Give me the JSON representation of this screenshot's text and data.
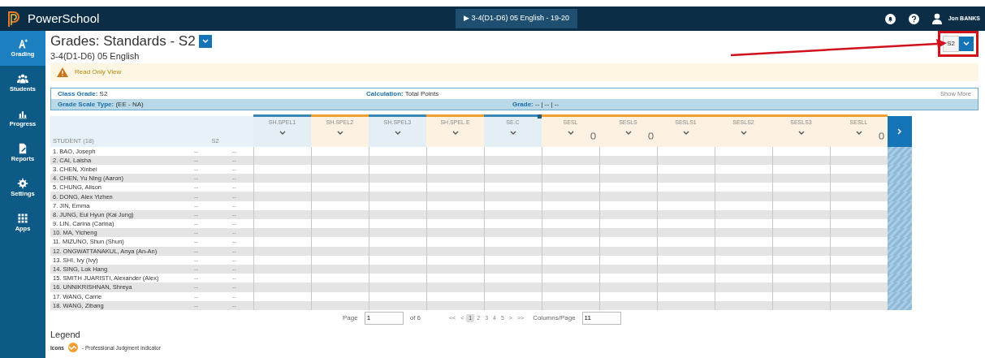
{
  "navbar": {
    "brand": "PowerSchool",
    "section_button": "▶ 3-4(D1-D6) 05 English - 19-20",
    "user": "Jon BANKS"
  },
  "sidebar": {
    "items": [
      {
        "label": "Grading",
        "selected": true
      },
      {
        "label": "Students",
        "selected": false
      },
      {
        "label": "Progress",
        "selected": false
      },
      {
        "label": "Reports",
        "selected": false
      },
      {
        "label": "Settings",
        "selected": false
      },
      {
        "label": "Apps",
        "selected": false
      }
    ]
  },
  "header": {
    "title": "Grades: Standards - S2",
    "subtitle": "3-4(D1-D6) 05 English",
    "term_select": "S2"
  },
  "alert": "Read Only View",
  "info": {
    "class_grade_label": "Class Grade:",
    "class_grade": "S2",
    "calculation_label": "Calculation:",
    "calculation": "Total Points",
    "show_link": "Show More",
    "scale_label": "Grade Scale Type:",
    "scale": "(EE - NA)",
    "grade_label": "Grade:",
    "grade": "-- | -- | --"
  },
  "table": {
    "student_header": "STUDENT (18)",
    "grade_header": "S2",
    "columns": [
      {
        "label": "SH.SPEL1",
        "color": "#3a87b5",
        "gear": false,
        "flag": false
      },
      {
        "label": "SH.SPEL2",
        "color": "#f0a030",
        "gear": false,
        "flag": false
      },
      {
        "label": "SH.SPEL3",
        "color": "#3a87b5",
        "gear": false,
        "flag": false
      },
      {
        "label": "SH.SPEL.E",
        "color": "#f0a030",
        "gear": false,
        "flag": false
      },
      {
        "label": "SE.C",
        "color": "#3a87b5",
        "gear": false,
        "flag": true
      },
      {
        "label": "SESL",
        "color": "#f0a030",
        "gear": true,
        "flag": false
      },
      {
        "label": "SESLS",
        "color": "#f0a030",
        "gear": true,
        "flag": false
      },
      {
        "label": "SESLS1",
        "color": "#f0a030",
        "gear": false,
        "flag": false
      },
      {
        "label": "SESLS2",
        "color": "#f0a030",
        "gear": false,
        "flag": false
      },
      {
        "label": "SESLS3",
        "color": "#f0a030",
        "gear": false,
        "flag": false
      },
      {
        "label": "SESLL",
        "color": "#f0a030",
        "gear": true,
        "flag": false
      }
    ],
    "rows": [
      {
        "student": "1.  BAO, Joseph",
        "grade_1": "--",
        "grade_2": "--"
      },
      {
        "student": "2.  CAI, Laisha",
        "grade_1": "--",
        "grade_2": "--"
      },
      {
        "student": "3.  CHEN, Xinbei",
        "grade_1": "--",
        "grade_2": "--"
      },
      {
        "student": "4.  CHEN, Yu Ning (Aaron)",
        "grade_1": "--",
        "grade_2": "--"
      },
      {
        "student": "5.  CHUNG, Alison",
        "grade_1": "--",
        "grade_2": "--"
      },
      {
        "student": "6.  DONG, Alex Yizhen",
        "grade_1": "--",
        "grade_2": "--"
      },
      {
        "student": "7.  JIN, Emma",
        "grade_1": "--",
        "grade_2": "--"
      },
      {
        "student": "8.  JUNG, Eui Hyun (Kai Jung)",
        "grade_1": "--",
        "grade_2": "--"
      },
      {
        "student": "9.  LIN, Carina (Carina)",
        "grade_1": "--",
        "grade_2": "--"
      },
      {
        "student": "10.  MA, Yicheng",
        "grade_1": "--",
        "grade_2": "--"
      },
      {
        "student": "11.  MIZUNO, Shun (Shun)",
        "grade_1": "--",
        "grade_2": "--"
      },
      {
        "student": "12.  ONGWATTANAKUL, Anya (An-An)",
        "grade_1": "--",
        "grade_2": "--"
      },
      {
        "student": "13.  SHI, Ivy (Ivy)",
        "grade_1": "--",
        "grade_2": "--"
      },
      {
        "student": "14.  SING, Lok Hang",
        "grade_1": "--",
        "grade_2": "--"
      },
      {
        "student": "15.  SMITH JUARISTI, Alexander (Alex)",
        "grade_1": "--",
        "grade_2": "--"
      },
      {
        "student": "16.  UNNIKRISHNAN, Shreya",
        "grade_1": "--",
        "grade_2": "--"
      },
      {
        "student": "17.  WANG, Carrie",
        "grade_1": "--",
        "grade_2": "--"
      },
      {
        "student": "18.  WANG, Zibang",
        "grade_1": "--",
        "grade_2": "--"
      }
    ]
  },
  "pagination": {
    "page_label": "Page",
    "page_value": "1",
    "of_label": "of 6",
    "links": [
      {
        "label": "<<",
        "selected": false
      },
      {
        "label": "<",
        "selected": false
      },
      {
        "label": "1",
        "selected": true
      },
      {
        "label": "2",
        "selected": false
      },
      {
        "label": "3",
        "selected": false
      },
      {
        "label": "4",
        "selected": false
      },
      {
        "label": "5",
        "selected": false
      },
      {
        "label": ">",
        "selected": false
      },
      {
        "label": ">>",
        "selected": false
      }
    ],
    "columns_label": "Columns/Page",
    "columns_value": "11"
  },
  "legend": {
    "title": "Legend",
    "icons_label": "Icons",
    "indicator_text": "- Professional Judgment Indicator"
  }
}
